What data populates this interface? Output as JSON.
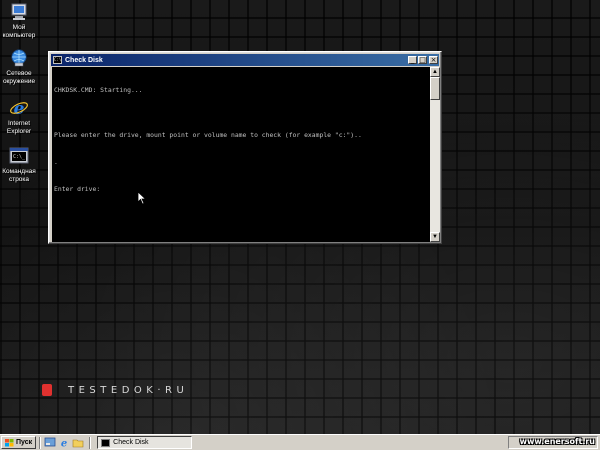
{
  "desktop": {
    "icons": [
      {
        "label": "Мой\nкомпьютер",
        "icon": "my-computer-icon"
      },
      {
        "label": "Сетевое\nокружение",
        "icon": "network-icon"
      },
      {
        "label": "Internet\nExplorer",
        "icon": "internet-explorer-icon"
      },
      {
        "label": "Командная\nстрока",
        "icon": "command-prompt-icon"
      }
    ],
    "brand": "TESTEDOK·RU",
    "brand_color": "#e0312f"
  },
  "window": {
    "title": "Check Disk",
    "minimize": "_",
    "maximize": "□",
    "close": "×",
    "console_lines": [
      "CHKDSK.CMD: Starting...",
      "",
      "Please enter the drive, mount point or volume name to check (for example \"c:\")..",
      ".",
      "Enter drive:"
    ]
  },
  "taskbar": {
    "start_label": "Пуск",
    "task_button_label": "Check Disk",
    "watermark": "www.enersoft.ru"
  }
}
